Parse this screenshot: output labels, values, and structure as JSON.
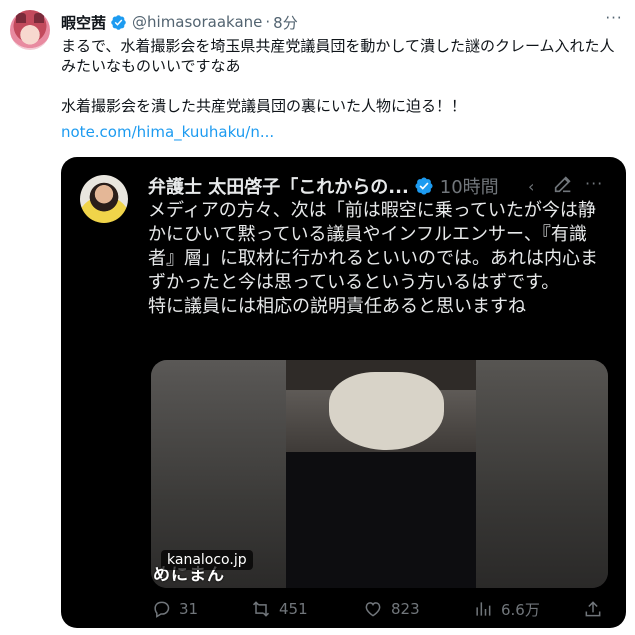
{
  "tweet": {
    "display_name": "暇空茜",
    "handle": "@himasoraakane",
    "separator": "·",
    "time": "8分",
    "text": "まるで、水着撮影会を埼玉県共産党議員団を動かして潰した謎のクレーム入れた人みたいなものいいですなあ\n\n水着撮影会を潰した共産党議員団の裏にいた人物に迫る！！",
    "link": "note.com/hima_kuuhaku/n...",
    "more_glyph": "···"
  },
  "quote": {
    "display_name": "弁護士 太田啓子「これからの...",
    "time": "10時間",
    "more_glyph": "···",
    "text": "メディアの方々、次は「前は暇空に乗っていたが今は静かにひいて黙っている議員やインフルエンサー、『有識者』層」に取材に行かれるといいのでは。あれは内心まずかったと今は思っているという方いるはずです。\n特に議員には相応の説明責任あると思いますね",
    "media": {
      "source_badge": "kanaloco.jp",
      "caption": "めにまん"
    },
    "actions": {
      "replies": "31",
      "retweets": "451",
      "likes": "823",
      "views": "6.6万"
    }
  },
  "colors": {
    "verified_blue": "#1d9bf0",
    "link_blue": "#1d9bf0",
    "muted_gray": "#536471",
    "dark_bg": "#000000"
  }
}
